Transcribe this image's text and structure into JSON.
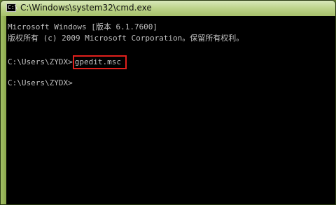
{
  "window": {
    "title": "C:\\Windows\\system32\\cmd.exe",
    "icon": "cmd-icon",
    "icon_text": "C:\\"
  },
  "console": {
    "lines": [
      "Microsoft Windows [版本 6.1.7600]",
      "版权所有 (c) 2009 Microsoft Corporation。保留所有权利。"
    ],
    "prompt1": "C:\\Users\\ZYDX>",
    "command": "gpedit.msc",
    "prompt2": "C:\\Users\\ZYDX>"
  },
  "colors": {
    "highlight": "#e0201c",
    "console_bg": "#000000",
    "console_text": "#c0c0c0"
  }
}
